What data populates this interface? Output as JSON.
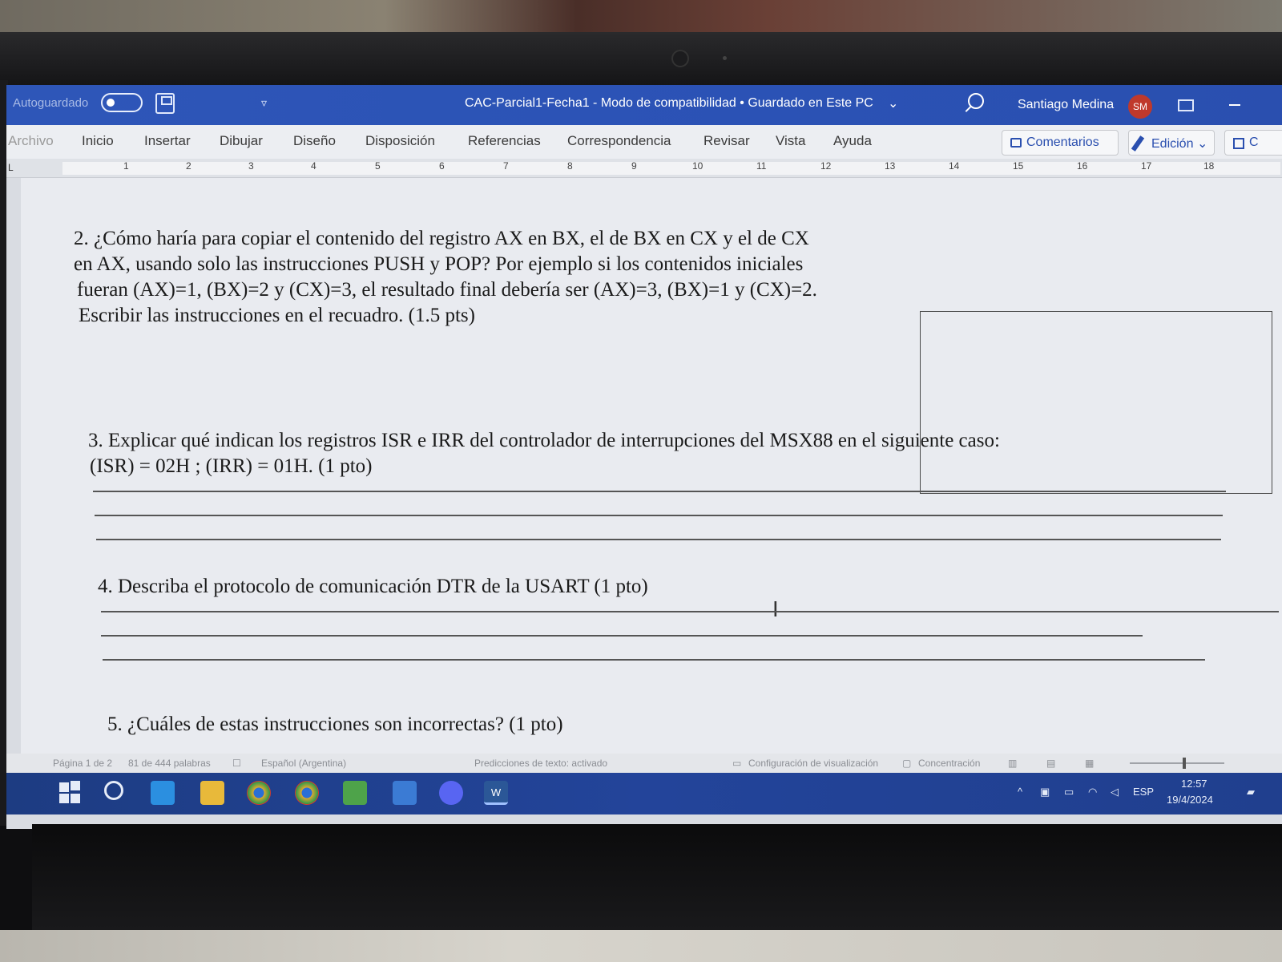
{
  "window": {
    "autosave_label": "Autoguardado",
    "title": "CAC-Parcial1-Fecha1  -  Modo de compatibilidad  •  Guardado en Este PC",
    "user_name": "Santiago Medina",
    "user_initials": "SM"
  },
  "ribbon": {
    "tabs": [
      "Archivo",
      "Inicio",
      "Insertar",
      "Dibujar",
      "Diseño",
      "Disposición",
      "Referencias",
      "Correspondencia",
      "Revisar",
      "Vista",
      "Ayuda"
    ],
    "comments_label": "Comentarios",
    "editing_label": "Edición",
    "share_label": "C"
  },
  "ruler": {
    "numbers": [
      "1",
      "2",
      "3",
      "4",
      "5",
      "6",
      "7",
      "8",
      "9",
      "10",
      "11",
      "12",
      "13",
      "14",
      "15",
      "16",
      "17",
      "18"
    ],
    "corner": "L"
  },
  "document": {
    "q2_lines": [
      "2. ¿Cómo haría para copiar el contenido del registro AX en BX, el de BX en CX y el de CX",
      "en AX, usando solo las instrucciones PUSH y POP? Por ejemplo si los contenidos iniciales",
      "fueran (AX)=1, (BX)=2 y (CX)=3, el resultado final debería ser (AX)=3, (BX)=1 y (CX)=2.",
      "Escribir las instrucciones en el recuadro. (1.5 pts)"
    ],
    "q3_lines": [
      "3. Explicar qué indican los registros ISR e IRR del controlador de interrupciones del MSX88 en el siguiente caso:",
      "(ISR) = 02H ; (IRR) = 01H. (1 pto)"
    ],
    "q4": "4. Describa el protocolo de comunicación DTR de la USART (1 pto)",
    "q5": "5. ¿Cuáles de estas instrucciones son incorrectas? (1 pto)"
  },
  "statusbar": {
    "page": "Página 1 de 2",
    "words": "81 de 444 palabras",
    "language": "Español (Argentina)",
    "predictions": "Predicciones de texto: activado",
    "display_settings": "Configuración de visualización",
    "focus": "Concentración"
  },
  "taskbar": {
    "language": "ESP",
    "time": "12:57",
    "date": "19/4/2024",
    "word_label": "W"
  },
  "colors": {
    "titlebar": "#2b52b5",
    "taskbar": "#23449a",
    "accent": "#2a4faf"
  }
}
